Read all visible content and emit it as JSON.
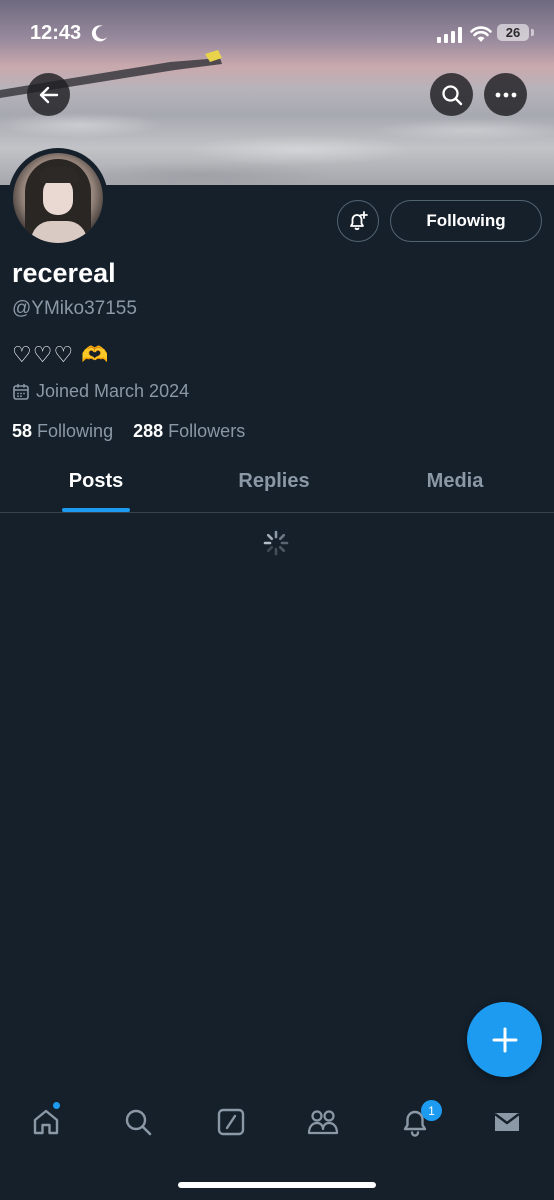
{
  "status_bar": {
    "time": "12:43",
    "battery": "26"
  },
  "profile": {
    "display_name": "recereal",
    "handle": "@YMiko37155",
    "bio": "♡♡♡ 🫶",
    "joined": "Joined March 2024",
    "following_count": "58",
    "following_label": "Following",
    "followers_count": "288",
    "followers_label": "Followers"
  },
  "actions": {
    "following_button": "Following"
  },
  "tabs": [
    {
      "label": "Posts",
      "active": true
    },
    {
      "label": "Replies",
      "active": false
    },
    {
      "label": "Media",
      "active": false
    }
  ],
  "notifications_badge": "1",
  "colors": {
    "accent": "#1d9bf0",
    "background": "#15202b",
    "secondary_text": "#8b98a5"
  },
  "icons": {
    "back": "back-arrow-icon",
    "search": "search-icon",
    "more": "more-icon",
    "bell": "bell-plus-icon",
    "calendar": "calendar-icon",
    "spinner": "loading-spinner-icon",
    "compose": "plus-icon",
    "home": "home-icon",
    "explore": "search-icon",
    "grok": "grok-icon",
    "communities": "communities-icon",
    "notifications": "bell-icon",
    "messages": "mail-icon"
  }
}
